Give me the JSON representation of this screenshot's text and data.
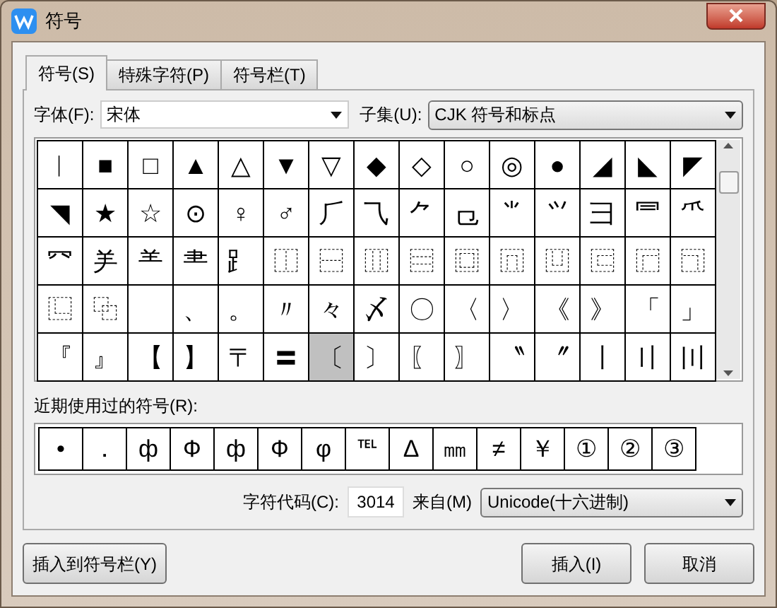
{
  "window": {
    "title": "符号"
  },
  "tabs": [
    {
      "label": "符号(S)",
      "selected": true
    },
    {
      "label": "特殊字符(P)",
      "selected": false
    },
    {
      "label": "符号栏(T)",
      "selected": false
    }
  ],
  "font_field": {
    "label": "字体(F):",
    "value": "宋体"
  },
  "subset_field": {
    "label": "子集(U):",
    "value": "CJK 符号和标点"
  },
  "symbols": [
    {
      "char": "︱",
      "selected": false
    },
    {
      "char": "■",
      "selected": false
    },
    {
      "char": "□",
      "selected": false
    },
    {
      "char": "▲",
      "selected": false
    },
    {
      "char": "△",
      "selected": false
    },
    {
      "char": "▼",
      "selected": false
    },
    {
      "char": "▽",
      "selected": false
    },
    {
      "char": "◆",
      "selected": false
    },
    {
      "char": "◇",
      "selected": false
    },
    {
      "char": "○",
      "selected": false
    },
    {
      "char": "◎",
      "selected": false
    },
    {
      "char": "●",
      "selected": false
    },
    {
      "char": "◢",
      "selected": false
    },
    {
      "char": "◣",
      "selected": false
    },
    {
      "char": "◤",
      "selected": false
    },
    {
      "char": "◥",
      "selected": false
    },
    {
      "char": "★",
      "selected": false
    },
    {
      "char": "☆",
      "selected": false
    },
    {
      "char": "⊙",
      "selected": false
    },
    {
      "char": "♀",
      "selected": false
    },
    {
      "char": "♂",
      "selected": false
    },
    {
      "char": "⺁",
      "selected": false
    },
    {
      "char": "⺄",
      "selected": false
    },
    {
      "char": "⺈",
      "selected": false
    },
    {
      "char": "⺋",
      "selected": false
    },
    {
      "char": "⺌",
      "selected": false
    },
    {
      "char": "⺍",
      "selected": false
    },
    {
      "char": "⺕",
      "selected": false
    },
    {
      "char": "⺜",
      "selected": false
    },
    {
      "char": "⺥",
      "selected": false
    },
    {
      "char": "⺳",
      "selected": false
    },
    {
      "char": "⺶",
      "selected": false
    },
    {
      "char": "⺷",
      "selected": false
    },
    {
      "char": "⺻",
      "selected": false
    },
    {
      "char": "⻊",
      "selected": false
    },
    {
      "char": "⿰",
      "selected": false
    },
    {
      "char": "⿱",
      "selected": false
    },
    {
      "char": "⿲",
      "selected": false
    },
    {
      "char": "⿳",
      "selected": false
    },
    {
      "char": "⿴",
      "selected": false
    },
    {
      "char": "⿵",
      "selected": false
    },
    {
      "char": "⿶",
      "selected": false
    },
    {
      "char": "⿷",
      "selected": false
    },
    {
      "char": "⿸",
      "selected": false
    },
    {
      "char": "⿹",
      "selected": false
    },
    {
      "char": "⿺",
      "selected": false
    },
    {
      "char": "⿻",
      "selected": false
    },
    {
      "selected": false
    },
    {
      "char": "、",
      "selected": false
    },
    {
      "char": "。",
      "selected": false
    },
    {
      "char": "〃",
      "selected": false
    },
    {
      "char": "々",
      "selected": false
    },
    {
      "char": "〆",
      "selected": false
    },
    {
      "char": "〇",
      "selected": false
    },
    {
      "char": "〈",
      "selected": false
    },
    {
      "char": "〉",
      "selected": false
    },
    {
      "char": "《",
      "selected": false
    },
    {
      "char": "》",
      "selected": false
    },
    {
      "char": "「",
      "selected": false
    },
    {
      "char": "」",
      "selected": false
    },
    {
      "char": "『",
      "selected": false
    },
    {
      "char": "』",
      "selected": false
    },
    {
      "char": "【",
      "selected": false
    },
    {
      "char": "】",
      "selected": false
    },
    {
      "char": "〒",
      "selected": false
    },
    {
      "char": "〓",
      "selected": false
    },
    {
      "char": "〔",
      "selected": true
    },
    {
      "char": "〕",
      "selected": false
    },
    {
      "char": "〖",
      "selected": false
    },
    {
      "char": "〗",
      "selected": false
    },
    {
      "char": "〝",
      "selected": false
    },
    {
      "char": "〞",
      "selected": false
    },
    {
      "char": "〡",
      "selected": false
    },
    {
      "char": "〢",
      "selected": false
    },
    {
      "char": "〣",
      "selected": false
    }
  ],
  "recent": {
    "label": "近期使用过的符号(R):",
    "symbols": [
      "•",
      "．",
      "ф",
      "Ф",
      "ф",
      "Ф",
      "φ",
      "℡",
      "Δ",
      "㎜",
      "≠",
      "￥",
      "①",
      "②",
      "③"
    ]
  },
  "char_code": {
    "label": "字符代码(C):",
    "value": "3014"
  },
  "source": {
    "label": "来自(M)",
    "value": "Unicode(十六进制)"
  },
  "buttons": [
    {
      "label": "插入到符号栏(Y)"
    },
    {
      "label": "插入(I)"
    },
    {
      "label": "取消"
    }
  ]
}
